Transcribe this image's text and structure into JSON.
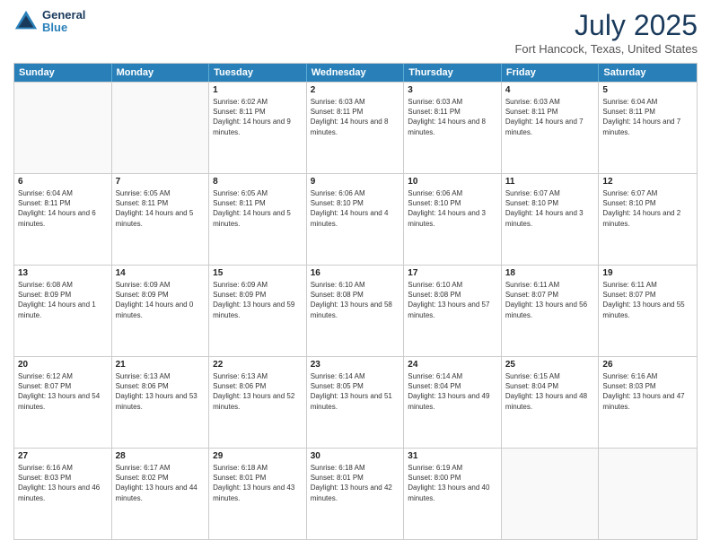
{
  "header": {
    "logo_line1": "General",
    "logo_line2": "Blue",
    "month": "July 2025",
    "location": "Fort Hancock, Texas, United States"
  },
  "weekdays": [
    "Sunday",
    "Monday",
    "Tuesday",
    "Wednesday",
    "Thursday",
    "Friday",
    "Saturday"
  ],
  "rows": [
    [
      {
        "day": "",
        "info": ""
      },
      {
        "day": "",
        "info": ""
      },
      {
        "day": "1",
        "info": "Sunrise: 6:02 AM\nSunset: 8:11 PM\nDaylight: 14 hours and 9 minutes."
      },
      {
        "day": "2",
        "info": "Sunrise: 6:03 AM\nSunset: 8:11 PM\nDaylight: 14 hours and 8 minutes."
      },
      {
        "day": "3",
        "info": "Sunrise: 6:03 AM\nSunset: 8:11 PM\nDaylight: 14 hours and 8 minutes."
      },
      {
        "day": "4",
        "info": "Sunrise: 6:03 AM\nSunset: 8:11 PM\nDaylight: 14 hours and 7 minutes."
      },
      {
        "day": "5",
        "info": "Sunrise: 6:04 AM\nSunset: 8:11 PM\nDaylight: 14 hours and 7 minutes."
      }
    ],
    [
      {
        "day": "6",
        "info": "Sunrise: 6:04 AM\nSunset: 8:11 PM\nDaylight: 14 hours and 6 minutes."
      },
      {
        "day": "7",
        "info": "Sunrise: 6:05 AM\nSunset: 8:11 PM\nDaylight: 14 hours and 5 minutes."
      },
      {
        "day": "8",
        "info": "Sunrise: 6:05 AM\nSunset: 8:11 PM\nDaylight: 14 hours and 5 minutes."
      },
      {
        "day": "9",
        "info": "Sunrise: 6:06 AM\nSunset: 8:10 PM\nDaylight: 14 hours and 4 minutes."
      },
      {
        "day": "10",
        "info": "Sunrise: 6:06 AM\nSunset: 8:10 PM\nDaylight: 14 hours and 3 minutes."
      },
      {
        "day": "11",
        "info": "Sunrise: 6:07 AM\nSunset: 8:10 PM\nDaylight: 14 hours and 3 minutes."
      },
      {
        "day": "12",
        "info": "Sunrise: 6:07 AM\nSunset: 8:10 PM\nDaylight: 14 hours and 2 minutes."
      }
    ],
    [
      {
        "day": "13",
        "info": "Sunrise: 6:08 AM\nSunset: 8:09 PM\nDaylight: 14 hours and 1 minute."
      },
      {
        "day": "14",
        "info": "Sunrise: 6:09 AM\nSunset: 8:09 PM\nDaylight: 14 hours and 0 minutes."
      },
      {
        "day": "15",
        "info": "Sunrise: 6:09 AM\nSunset: 8:09 PM\nDaylight: 13 hours and 59 minutes."
      },
      {
        "day": "16",
        "info": "Sunrise: 6:10 AM\nSunset: 8:08 PM\nDaylight: 13 hours and 58 minutes."
      },
      {
        "day": "17",
        "info": "Sunrise: 6:10 AM\nSunset: 8:08 PM\nDaylight: 13 hours and 57 minutes."
      },
      {
        "day": "18",
        "info": "Sunrise: 6:11 AM\nSunset: 8:07 PM\nDaylight: 13 hours and 56 minutes."
      },
      {
        "day": "19",
        "info": "Sunrise: 6:11 AM\nSunset: 8:07 PM\nDaylight: 13 hours and 55 minutes."
      }
    ],
    [
      {
        "day": "20",
        "info": "Sunrise: 6:12 AM\nSunset: 8:07 PM\nDaylight: 13 hours and 54 minutes."
      },
      {
        "day": "21",
        "info": "Sunrise: 6:13 AM\nSunset: 8:06 PM\nDaylight: 13 hours and 53 minutes."
      },
      {
        "day": "22",
        "info": "Sunrise: 6:13 AM\nSunset: 8:06 PM\nDaylight: 13 hours and 52 minutes."
      },
      {
        "day": "23",
        "info": "Sunrise: 6:14 AM\nSunset: 8:05 PM\nDaylight: 13 hours and 51 minutes."
      },
      {
        "day": "24",
        "info": "Sunrise: 6:14 AM\nSunset: 8:04 PM\nDaylight: 13 hours and 49 minutes."
      },
      {
        "day": "25",
        "info": "Sunrise: 6:15 AM\nSunset: 8:04 PM\nDaylight: 13 hours and 48 minutes."
      },
      {
        "day": "26",
        "info": "Sunrise: 6:16 AM\nSunset: 8:03 PM\nDaylight: 13 hours and 47 minutes."
      }
    ],
    [
      {
        "day": "27",
        "info": "Sunrise: 6:16 AM\nSunset: 8:03 PM\nDaylight: 13 hours and 46 minutes."
      },
      {
        "day": "28",
        "info": "Sunrise: 6:17 AM\nSunset: 8:02 PM\nDaylight: 13 hours and 44 minutes."
      },
      {
        "day": "29",
        "info": "Sunrise: 6:18 AM\nSunset: 8:01 PM\nDaylight: 13 hours and 43 minutes."
      },
      {
        "day": "30",
        "info": "Sunrise: 6:18 AM\nSunset: 8:01 PM\nDaylight: 13 hours and 42 minutes."
      },
      {
        "day": "31",
        "info": "Sunrise: 6:19 AM\nSunset: 8:00 PM\nDaylight: 13 hours and 40 minutes."
      },
      {
        "day": "",
        "info": ""
      },
      {
        "day": "",
        "info": ""
      }
    ]
  ]
}
